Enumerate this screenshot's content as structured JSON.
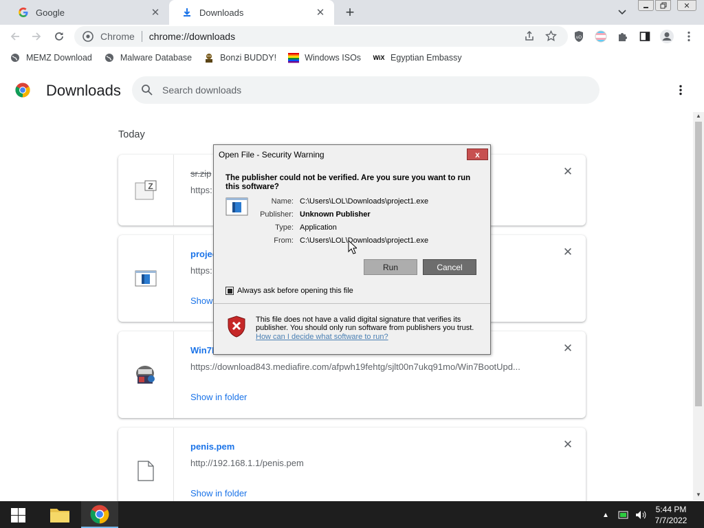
{
  "browser": {
    "tabs": [
      {
        "label": "Google",
        "icon": "google-g-icon"
      },
      {
        "label": "Downloads",
        "icon": "download-icon"
      }
    ],
    "omnibox": {
      "site_chip": "Chrome",
      "url": "chrome://downloads"
    },
    "bookmarks": [
      {
        "label": "MEMZ Download",
        "icon": "globe-icon"
      },
      {
        "label": "Malware Database",
        "icon": "globe-icon"
      },
      {
        "label": "Bonzi BUDDY!",
        "icon": "bonzi-icon"
      },
      {
        "label": "Windows ISOs",
        "icon": "windows-flag-icon"
      },
      {
        "label": "Egyptian Embassy",
        "icon": "wix-icon"
      }
    ]
  },
  "downloads_page": {
    "title": "Downloads",
    "search_placeholder": "Search downloads",
    "day_label": "Today",
    "items": [
      {
        "name": "sr.zip",
        "url": "https:",
        "cancelled": true,
        "show_in_folder": ""
      },
      {
        "name": "projec",
        "url": "https:",
        "cancelled": false,
        "show_in_folder": "Show"
      },
      {
        "name": "Win7E",
        "url": "https://download843.mediafire.com/afpwh19fehtg/sjlt00n7ukq91mo/Win7BootUpd...",
        "cancelled": false,
        "show_in_folder": "Show in folder"
      },
      {
        "name": "penis.pem",
        "url": "http://192.168.1.1/penis.pem",
        "cancelled": false,
        "show_in_folder": "Show in folder"
      }
    ]
  },
  "dialog": {
    "title": "Open File - Security Warning",
    "close_label": "x",
    "heading": "The publisher could not be verified.  Are you sure you want to run this software?",
    "fields": [
      {
        "label": "Name:",
        "value": "C:\\Users\\LOL\\Downloads\\project1.exe",
        "bold": false
      },
      {
        "label": "Publisher:",
        "value": "Unknown Publisher",
        "bold": true
      },
      {
        "label": "Type:",
        "value": "Application",
        "bold": false
      },
      {
        "label": "From:",
        "value": "C:\\Users\\LOL\\Downloads\\project1.exe",
        "bold": false
      }
    ],
    "run_label": "Run",
    "cancel_label": "Cancel",
    "checkbox_label": "Always ask before opening this file",
    "checkbox_checked": true,
    "warning_text": "This file does not have a valid digital signature that verifies its publisher.  You should only run software from publishers you trust.",
    "link_text": "How can I decide what software to run?"
  },
  "taskbar": {
    "time": "5:44 PM",
    "date": "7/7/2022"
  },
  "colors": {
    "accent_blue": "#1a73e8",
    "dialog_close_red": "#c75050",
    "taskbar": "#1e1e1e"
  }
}
